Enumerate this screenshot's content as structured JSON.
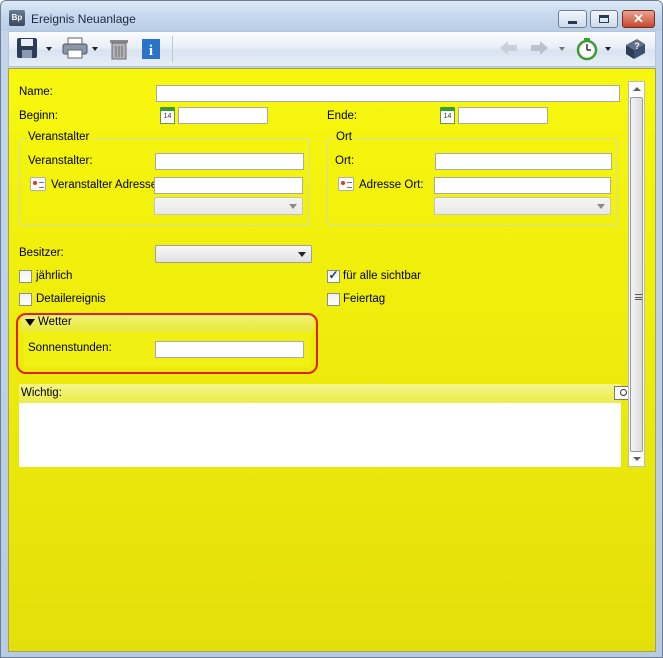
{
  "window": {
    "app_icon_text": "Bp",
    "title": "Ereignis Neuanlage",
    "close_glyph": "✕"
  },
  "toolbar": {
    "icons": [
      "save-icon",
      "print-icon",
      "trash-icon",
      "info-icon",
      "back-arrow-icon",
      "forward-arrow-icon",
      "timer-icon",
      "help-book-icon"
    ],
    "info_glyph": "i",
    "help_glyph": "?"
  },
  "form": {
    "name_label": "Name:",
    "name_value": "",
    "beginn_label": "Beginn:",
    "beginn_value": "",
    "ende_label": "Ende:",
    "ende_value": "",
    "calendar_day": "14",
    "veranstalter_group": {
      "title": "Veranstalter",
      "veranstalter_label": "Veranstalter:",
      "veranstalter_value": "",
      "adresse_label": "Veranstalter Adresse:",
      "adresse_value": ""
    },
    "ort_group": {
      "title": "Ort",
      "ort_label": "Ort:",
      "ort_value": "",
      "adresse_label": "Adresse Ort:",
      "adresse_value": ""
    },
    "besitzer_label": "Besitzer:",
    "checkboxes": {
      "jaehrlich": {
        "label": "jährlich",
        "checked": false
      },
      "fuer_alle_sichtbar": {
        "label": "für alle sichtbar",
        "checked": true,
        "tick": "✓"
      },
      "detailereignis": {
        "label": "Detailereignis",
        "checked": false
      },
      "feiertag": {
        "label": "Feiertag",
        "checked": false
      }
    },
    "wetter": {
      "title": "Wetter",
      "sonnenstunden_label": "Sonnenstunden:",
      "sonnenstunden_value": ""
    },
    "wichtig_label": "Wichtig:",
    "wichtig_value": ""
  },
  "colors": {
    "form_background": "#f3f30d",
    "highlight_border": "#e02020"
  }
}
